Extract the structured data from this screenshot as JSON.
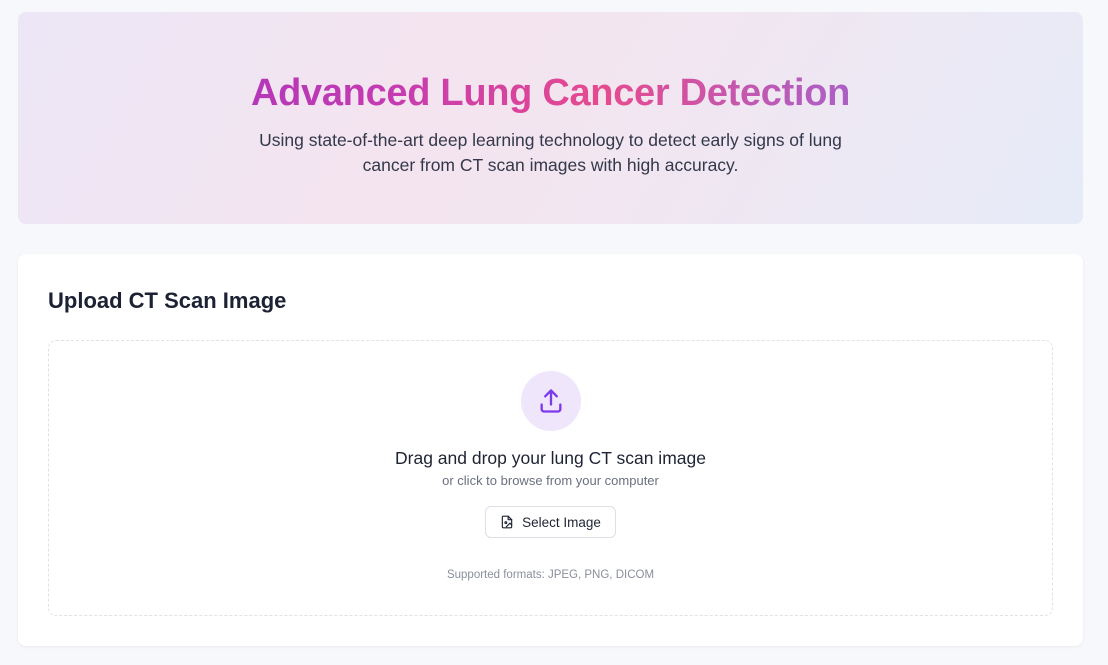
{
  "hero": {
    "title": "Advanced Lung Cancer Detection",
    "subtitle": "Using state-of-the-art deep learning technology to detect early signs of lung cancer from CT scan images with high accuracy."
  },
  "upload": {
    "title": "Upload CT Scan Image",
    "dropzone": {
      "icon": "upload-icon",
      "main_text": "Drag and drop your lung CT scan image",
      "sub_text": "or click to browse from your computer",
      "button_label": "Select Image",
      "button_icon": "file-image-icon",
      "formats_text": "Supported formats: JPEG, PNG, DICOM"
    }
  },
  "colors": {
    "accent": "#7c3aed",
    "title_gradient": [
      "#9a2fc2",
      "#e64b8e",
      "#7e6ad8"
    ],
    "icon_circle_bg": "#efe6fb"
  }
}
